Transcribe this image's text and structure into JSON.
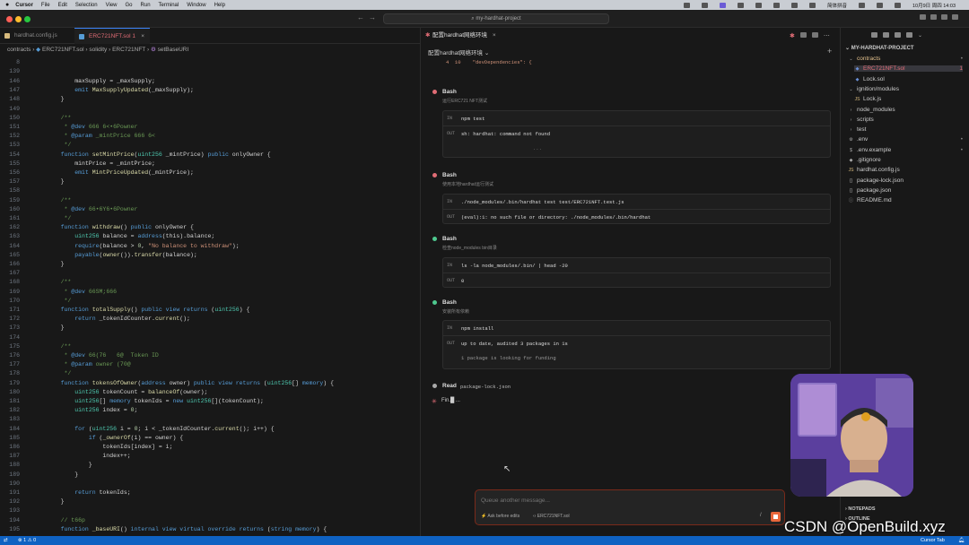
{
  "menubar": {
    "app": "Cursor",
    "items": [
      "File",
      "Edit",
      "Selection",
      "View",
      "Go",
      "Run",
      "Terminal",
      "Window",
      "Help"
    ],
    "clock": "10月9日 周四 14:03",
    "ime": "简体拼音"
  },
  "titlebar": {
    "search_text": "my-hardhat-project"
  },
  "editor": {
    "tabs": [
      {
        "label": "hardhat.config.js",
        "color": "#d7ba7d"
      },
      {
        "label": "ERC721NFT.sol 1",
        "color": "#569cd6"
      }
    ],
    "breadcrumb": [
      "contracts",
      "ERC721NFT.sol",
      "solidity",
      "ERC721NFT",
      "setBaseURI"
    ],
    "sticky_lines": [
      "8",
      "139"
    ],
    "lines": [
      {
        "n": "146",
        "t": "        maxSupply = _maxSupply;"
      },
      {
        "n": "147",
        "t": "        emit MaxSupplyUpdated(_maxSupply);"
      },
      {
        "n": "148",
        "t": "    }"
      },
      {
        "n": "149",
        "t": ""
      },
      {
        "n": "150",
        "t": "    /**"
      },
      {
        "n": "151",
        "t": "     * @dev 666 6<•6Powner"
      },
      {
        "n": "152",
        "t": "     * @param _mintPrice 666 6<"
      },
      {
        "n": "153",
        "t": "     */"
      },
      {
        "n": "154",
        "t": "    function setMintPrice(uint256 _mintPrice) public onlyOwner {"
      },
      {
        "n": "155",
        "t": "        mintPrice = _mintPrice;"
      },
      {
        "n": "156",
        "t": "        emit MintPriceUpdated(_mintPrice);"
      },
      {
        "n": "157",
        "t": "    }"
      },
      {
        "n": "158",
        "t": ""
      },
      {
        "n": "159",
        "t": "    /**"
      },
      {
        "n": "160",
        "t": "     * @dev 66•6Y6•6Powner"
      },
      {
        "n": "161",
        "t": "     */"
      },
      {
        "n": "162",
        "t": "    function withdraw() public onlyOwner {"
      },
      {
        "n": "163",
        "t": "        uint256 balance = address(this).balance;"
      },
      {
        "n": "164",
        "t": "        require(balance > 0, \"No balance to withdraw\");"
      },
      {
        "n": "165",
        "t": "        payable(owner()).transfer(balance);"
      },
      {
        "n": "166",
        "t": "    }"
      },
      {
        "n": "167",
        "t": ""
      },
      {
        "n": "168",
        "t": "    /**"
      },
      {
        "n": "169",
        "t": "     * @dev 66SM;666"
      },
      {
        "n": "170",
        "t": "     */"
      },
      {
        "n": "171",
        "t": "    function totalSupply() public view returns (uint256) {"
      },
      {
        "n": "172",
        "t": "        return _tokenIdCounter.current();"
      },
      {
        "n": "173",
        "t": "    }"
      },
      {
        "n": "174",
        "t": ""
      },
      {
        "n": "175",
        "t": "    /**"
      },
      {
        "n": "176",
        "t": "     * @dev 66(76   6@  Token ID"
      },
      {
        "n": "177",
        "t": "     * @param owner (70@"
      },
      {
        "n": "178",
        "t": "     */"
      },
      {
        "n": "179",
        "t": "    function tokensOfOwner(address owner) public view returns (uint256[] memory) {"
      },
      {
        "n": "180",
        "t": "        uint256 tokenCount = balanceOf(owner);"
      },
      {
        "n": "181",
        "t": "        uint256[] memory tokenIds = new uint256[](tokenCount);"
      },
      {
        "n": "182",
        "t": "        uint256 index = 0;"
      },
      {
        "n": "183",
        "t": ""
      },
      {
        "n": "184",
        "t": "        for (uint256 i = 0; i < _tokenIdCounter.current(); i++) {"
      },
      {
        "n": "185",
        "t": "            if (_ownerOf(i) == owner) {"
      },
      {
        "n": "186",
        "t": "                tokenIds[index] = i;"
      },
      {
        "n": "187",
        "t": "                index++;"
      },
      {
        "n": "188",
        "t": "            }"
      },
      {
        "n": "189",
        "t": "        }"
      },
      {
        "n": "190",
        "t": ""
      },
      {
        "n": "191",
        "t": "        return tokenIds;"
      },
      {
        "n": "192",
        "t": "    }"
      },
      {
        "n": "193",
        "t": ""
      },
      {
        "n": "194",
        "t": "    // t66p"
      },
      {
        "n": "195",
        "t": "    function _baseURI() internal view virtual override returns (string memory) {"
      }
    ]
  },
  "chat": {
    "tab_label": "配置hardhat网络环境",
    "sub_label": "配置hardhat网络环境",
    "top_snippet": "4  10    \"devDependencies\": {",
    "steps": [
      {
        "title": "Bash",
        "desc": "运行ERC721 NFT测试",
        "in": "npm test",
        "out": "sh: hardhat: command not found",
        "out2": "..."
      },
      {
        "title": "Bash",
        "desc": "使用本地hardhat运行测试",
        "in": "./node_modules/.bin/hardhat test test/ERC721NFT.test.js",
        "out": "(eval):1: no such file or directory: ./node_modules/.bin/hardhat",
        "out2": ""
      },
      {
        "title": "Bash",
        "desc": "检查node_modules bin目录",
        "in": "ls -la node_modules/.bin/ | head -20",
        "out": "0",
        "out2": ""
      },
      {
        "title": "Bash",
        "desc": "安装所有依赖",
        "in": "npm install",
        "out": "up to date, audited 3 packages in 1s",
        "out2": "1 package is looking for funding"
      }
    ],
    "io_in": "IN",
    "io_out": "OUT",
    "read_label": "Read",
    "read_file": "package-lock.json",
    "thinking": "Fin.█ ...",
    "composer": {
      "placeholder": "Queue another message...",
      "mode": "Ask before edits",
      "file": "ERC721NFT.sol",
      "slash": "/"
    }
  },
  "explorer": {
    "project": "MY-HARDHAT-PROJECT",
    "items": [
      {
        "label": "contracts",
        "depth": 1,
        "kind": "folder-open",
        "color": "#e2c08d",
        "badge": "•"
      },
      {
        "label": "ERC721NFT.sol",
        "depth": 2,
        "kind": "sol",
        "color": "#e06c75",
        "badge": "1"
      },
      {
        "label": "Lock.sol",
        "depth": 2,
        "kind": "sol",
        "color": "#ccc",
        "badge": ""
      },
      {
        "label": "ignition/modules",
        "depth": 1,
        "kind": "folder-open",
        "color": "#ccc",
        "badge": ""
      },
      {
        "label": "Lock.js",
        "depth": 2,
        "kind": "js",
        "color": "#ccc",
        "badge": ""
      },
      {
        "label": "node_modules",
        "depth": 1,
        "kind": "folder",
        "color": "#ccc",
        "badge": ""
      },
      {
        "label": "scripts",
        "depth": 1,
        "kind": "folder",
        "color": "#ccc",
        "badge": ""
      },
      {
        "label": "test",
        "depth": 1,
        "kind": "folder",
        "color": "#ccc",
        "badge": ""
      },
      {
        "label": ".env",
        "depth": 1,
        "kind": "gear",
        "color": "#ccc",
        "badge": "•"
      },
      {
        "label": ".env.example",
        "depth": 1,
        "kind": "dollar",
        "color": "#ccc",
        "badge": "•"
      },
      {
        "label": ".gitignore",
        "depth": 1,
        "kind": "git",
        "color": "#ccc",
        "badge": ""
      },
      {
        "label": "hardhat.config.js",
        "depth": 1,
        "kind": "js",
        "color": "#ccc",
        "badge": ""
      },
      {
        "label": "package-lock.json",
        "depth": 1,
        "kind": "json",
        "color": "#ccc",
        "badge": ""
      },
      {
        "label": "package.json",
        "depth": 1,
        "kind": "json",
        "color": "#ccc",
        "badge": ""
      },
      {
        "label": "README.md",
        "depth": 1,
        "kind": "info",
        "color": "#ccc",
        "badge": ""
      }
    ],
    "notepads": "NOTEPADS",
    "outline": "OUTLINE"
  },
  "statusbar": {
    "problems": "⊗ 1 ⚠ 0",
    "right": "Cursor Tab"
  },
  "watermark": "CSDN @OpenBuild.xyz",
  "colors": {
    "accent": "#3b82f6",
    "error": "#e06c75",
    "statusbar": "#0f62c2"
  }
}
